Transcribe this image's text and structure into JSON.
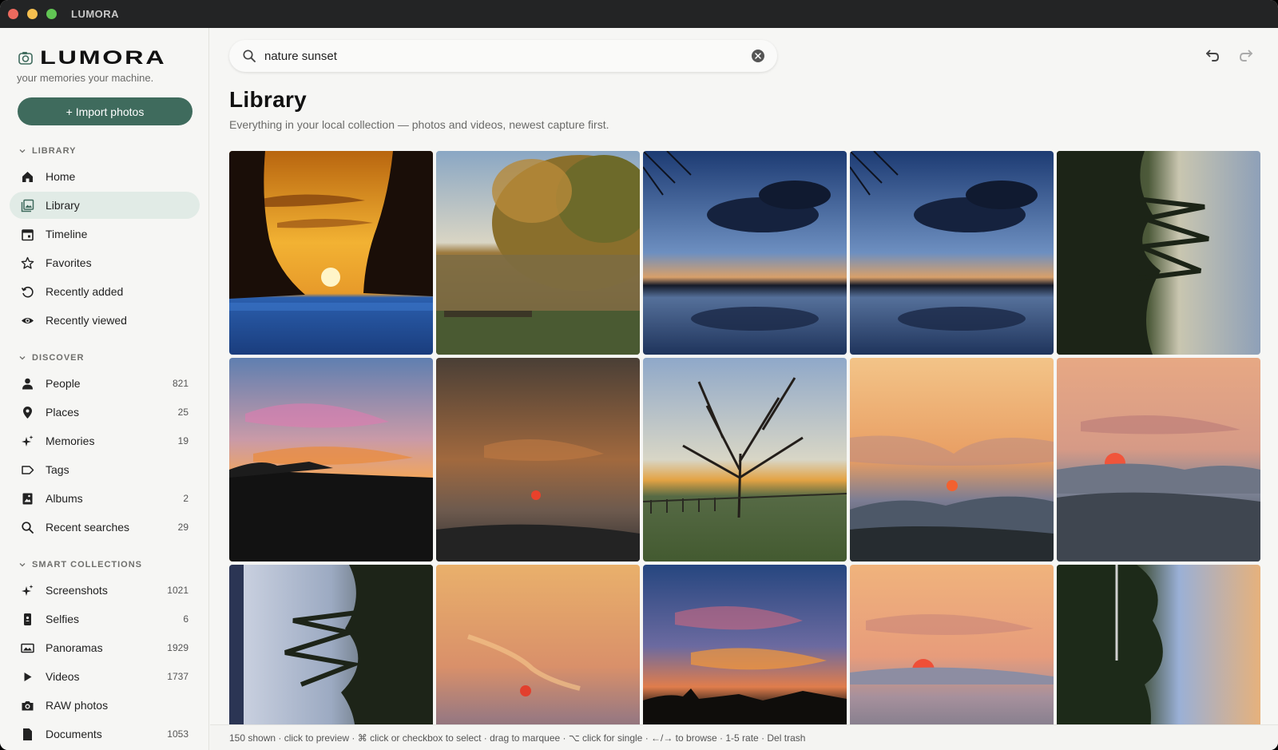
{
  "window": {
    "title": "LUMORA"
  },
  "brand": {
    "name": "LUMORA",
    "tagline": "your memories your machine."
  },
  "import_button": "+ Import photos",
  "sections": {
    "library": {
      "label": "LIBRARY",
      "items": [
        {
          "label": "Home",
          "icon": "home-icon"
        },
        {
          "label": "Library",
          "icon": "library-icon",
          "active": true
        },
        {
          "label": "Timeline",
          "icon": "calendar-icon"
        },
        {
          "label": "Favorites",
          "icon": "star-icon"
        },
        {
          "label": "Recently added",
          "icon": "history-icon"
        },
        {
          "label": "Recently viewed",
          "icon": "eye-icon"
        }
      ]
    },
    "discover": {
      "label": "DISCOVER",
      "items": [
        {
          "label": "People",
          "count": "821",
          "icon": "person-icon"
        },
        {
          "label": "Places",
          "count": "25",
          "icon": "pin-icon"
        },
        {
          "label": "Memories",
          "count": "19",
          "icon": "sparkle-icon"
        },
        {
          "label": "Tags",
          "count": "",
          "icon": "tag-icon"
        },
        {
          "label": "Albums",
          "count": "2",
          "icon": "album-icon"
        },
        {
          "label": "Recent searches",
          "count": "29",
          "icon": "search-icon"
        }
      ]
    },
    "smart": {
      "label": "SMART COLLECTIONS",
      "items": [
        {
          "label": "Screenshots",
          "count": "1021",
          "icon": "sparkle-icon"
        },
        {
          "label": "Selfies",
          "count": "6",
          "icon": "phone-icon"
        },
        {
          "label": "Panoramas",
          "count": "1929",
          "icon": "panorama-icon"
        },
        {
          "label": "Videos",
          "count": "1737",
          "icon": "play-icon"
        },
        {
          "label": "RAW photos",
          "count": "",
          "icon": "camera-icon"
        },
        {
          "label": "Documents",
          "count": "1053",
          "icon": "document-icon"
        }
      ]
    }
  },
  "search": {
    "value": "nature sunset",
    "placeholder": "Search"
  },
  "page": {
    "title": "Library",
    "subtitle": "Everything in your local collection — photos and videos, newest capture first."
  },
  "status": "150 shown · click to preview · ⌘ click or checkbox to select · drag to marquee · ⌥ click for single · ←/→ to browse · 1-5 rate · Del trash",
  "photos": [
    "sunset-cliff",
    "autumn-lake",
    "blue-sky-reflection",
    "blue-sky-reflection",
    "rotated-trees",
    "pink-sky-silhouette",
    "hazy-red-sun",
    "bare-tree-field",
    "orange-haze-mountains",
    "red-sun-mountains",
    "rotated-trees-2",
    "hazy-red-sun-2",
    "dramatic-sunset-clouds",
    "hazy-sun-horizon",
    "rotated-tower"
  ],
  "colors": {
    "accent": "#3f6b5d",
    "active_bg": "#e1ebe6"
  }
}
